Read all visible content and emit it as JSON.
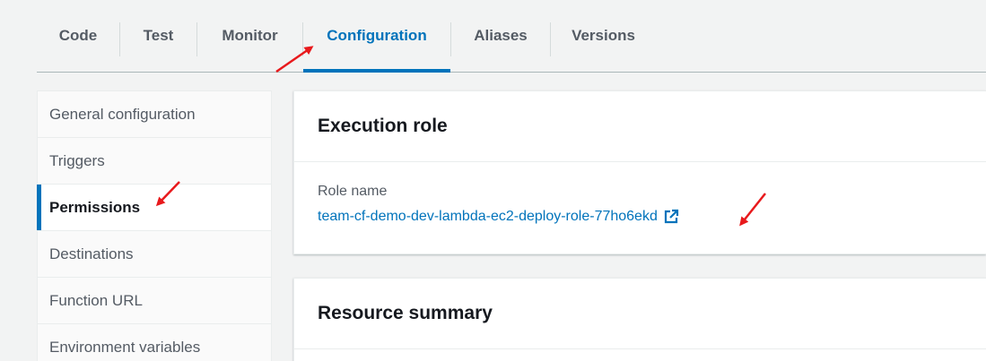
{
  "tabs": [
    {
      "label": "Code"
    },
    {
      "label": "Test"
    },
    {
      "label": "Monitor"
    },
    {
      "label": "Configuration",
      "active": true
    },
    {
      "label": "Aliases"
    },
    {
      "label": "Versions"
    }
  ],
  "sidenav": {
    "items": [
      {
        "label": "General configuration"
      },
      {
        "label": "Triggers"
      },
      {
        "label": "Permissions",
        "active": true
      },
      {
        "label": "Destinations"
      },
      {
        "label": "Function URL"
      },
      {
        "label": "Environment variables"
      }
    ]
  },
  "execution_role": {
    "title": "Execution role",
    "role_label": "Role name",
    "role_value": "team-cf-demo-dev-lambda-ec2-deploy-role-77ho6ekd",
    "link_icon": "external-link-icon"
  },
  "resource_summary": {
    "title": "Resource summary"
  },
  "colors": {
    "accent": "#0073bb",
    "annotation": "#e8191c"
  }
}
